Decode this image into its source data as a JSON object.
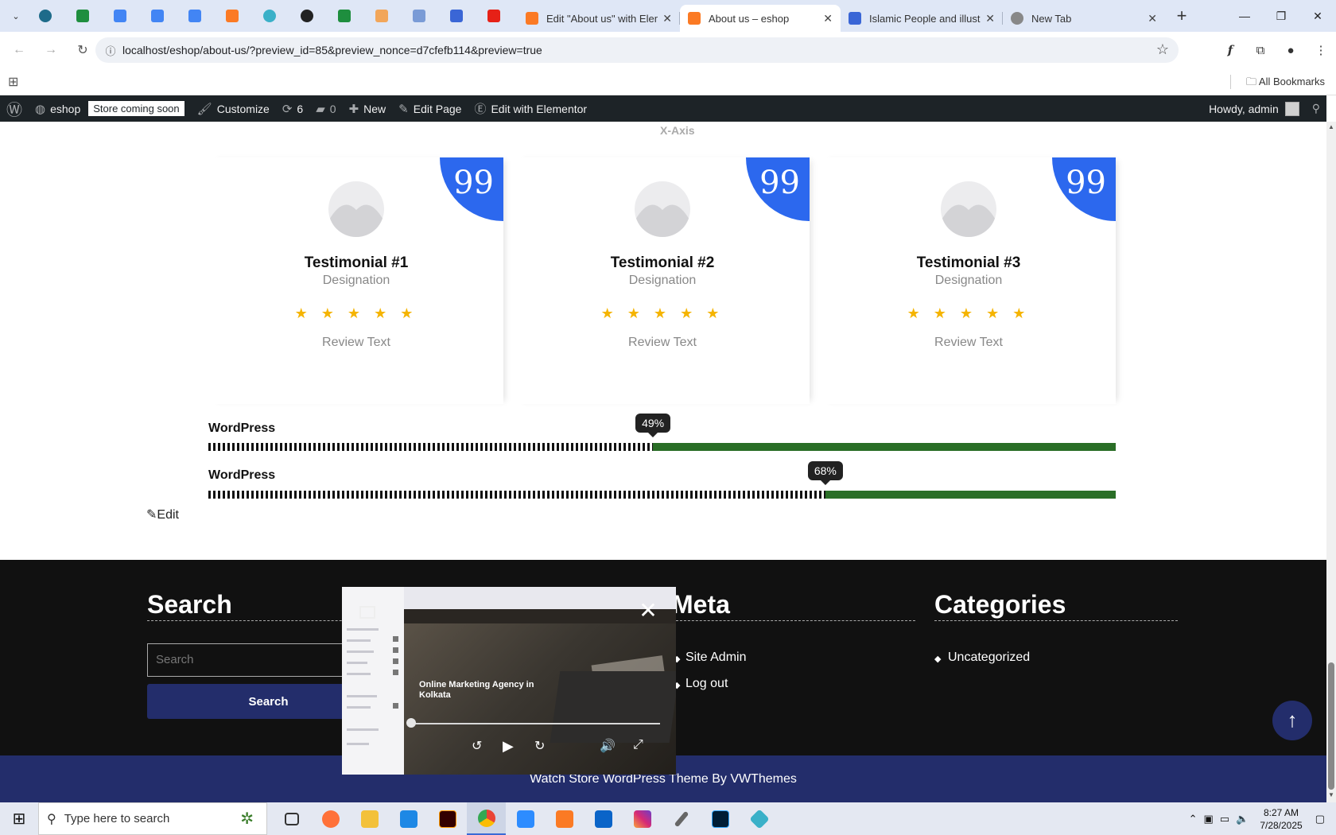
{
  "browser": {
    "pinned_tabs": [
      "wordpress-icon",
      "sheets-icon",
      "docs-icon",
      "docs-icon",
      "docs-icon",
      "xampp-icon",
      "colorful-icon",
      "openai-icon",
      "sheets-icon",
      "app-icon",
      "forms-icon",
      "docs-icon",
      "youtube-icon"
    ],
    "tabs": [
      {
        "title": "Edit \"About us\" with Elem",
        "icon": "xampp-icon",
        "active": false
      },
      {
        "title": "About us – eshop",
        "icon": "xampp-icon",
        "active": true
      },
      {
        "title": "Islamic People and illustr",
        "icon": "docs-icon",
        "active": false
      },
      {
        "title": "New Tab",
        "icon": "chrome-icon",
        "active": false
      }
    ],
    "url": "localhost/eshop/about-us/?preview_id=85&preview_nonce=d7cfefb114&preview=true",
    "bookmarks_all": "All Bookmarks"
  },
  "admin_bar": {
    "site_name": "eshop",
    "store_badge": "Store coming soon",
    "customize": "Customize",
    "updates_count": "6",
    "comments_count": "0",
    "new": "New",
    "edit_page": "Edit Page",
    "edit_elementor": "Edit with Elementor",
    "howdy": "Howdy, admin"
  },
  "page": {
    "x_axis_label": "X-Axis",
    "testimonials": [
      {
        "name": "Testimonial #1",
        "designation": "Designation",
        "stars": "★ ★ ★ ★ ★",
        "rating": 5,
        "review": "Review Text",
        "quote_glyph": "99"
      },
      {
        "name": "Testimonial #2",
        "designation": "Designation",
        "stars": "★ ★ ★ ★ ★",
        "rating": 5,
        "review": "Review Text",
        "quote_glyph": "99"
      },
      {
        "name": "Testimonial #3",
        "designation": "Designation",
        "stars": "★ ★ ★ ★ ★",
        "rating": 5,
        "review": "Review Text",
        "quote_glyph": "99"
      }
    ],
    "skills": [
      {
        "label": "WordPress",
        "percent_text": "49%",
        "percent": 49
      },
      {
        "label": "WordPress",
        "percent_text": "68%",
        "percent": 68
      }
    ],
    "edit_link": "Edit"
  },
  "footer": {
    "search_title": "Search",
    "search_placeholder": "Search",
    "search_button": "Search",
    "meta_title": "Meta",
    "meta_links": [
      "Site Admin",
      "Log out"
    ],
    "categories_title": "Categories",
    "categories": [
      "Uncategorized"
    ],
    "copyright": "Watch Store WordPress Theme By VWThemes"
  },
  "video_pip": {
    "title": "Online Marketing Agency in Kolkata",
    "progress": 0.0
  },
  "taskbar": {
    "search_placeholder": "Type here to search",
    "time": "8:27 AM",
    "date": "7/28/2025",
    "apps": [
      "task-view-icon",
      "firefox-icon",
      "file-explorer-icon",
      "vscode-icon",
      "illustrator-icon",
      "chrome-icon",
      "zoom-icon",
      "xampp-icon",
      "outlook-icon",
      "instagram-icon",
      "pen-icon",
      "photoshop-icon",
      "app-icon"
    ]
  },
  "colors": {
    "accent_blue": "#2c68ee",
    "footer_navy": "#232d6b",
    "skill_green": "#2a6e27",
    "star_gold": "#f5b400"
  }
}
